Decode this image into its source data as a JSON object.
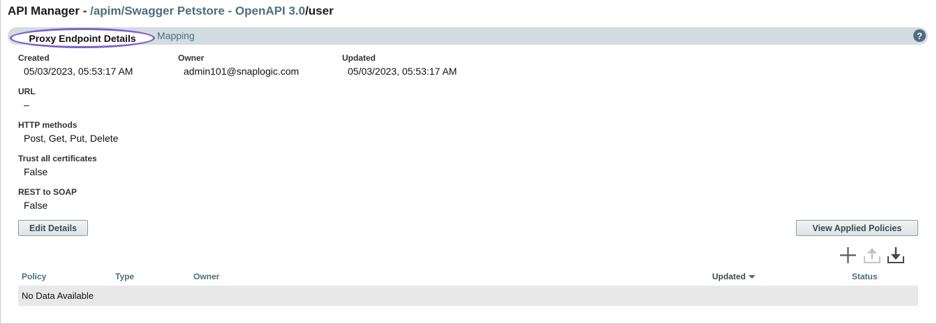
{
  "header": {
    "app_name": "API Manager - ",
    "path_link": "/apim/Swagger Petstore - OpenAPI 3.0",
    "path_tail": "/user"
  },
  "tabs": [
    {
      "label": "Proxy Endpoint Details",
      "active": true
    },
    {
      "label": "Mapping",
      "active": false
    }
  ],
  "help": {
    "glyph": "?"
  },
  "details": {
    "created": {
      "label": "Created",
      "value": "05/03/2023, 05:53:17 AM"
    },
    "owner": {
      "label": "Owner",
      "value": "admin101@snaplogic.com"
    },
    "updated": {
      "label": "Updated",
      "value": "05/03/2023, 05:53:17 AM"
    },
    "url": {
      "label": "URL",
      "value": "–"
    },
    "http_methods": {
      "label": "HTTP methods",
      "value": "Post, Get, Put, Delete"
    },
    "trust_certs": {
      "label": "Trust all certificates",
      "value": "False"
    },
    "rest_to_soap": {
      "label": "REST to SOAP",
      "value": "False"
    }
  },
  "buttons": {
    "edit_details": "Edit Details",
    "view_applied_policies": "View Applied Policies"
  },
  "toolbar_icons": [
    "add-icon",
    "upload-icon",
    "download-icon"
  ],
  "policy_table": {
    "columns": [
      "Policy",
      "Type",
      "Owner",
      "Updated",
      "Status"
    ],
    "sorted_column": "Updated",
    "sort_direction": "descending",
    "empty_text": "No Data Available"
  },
  "colors": {
    "accent": "#4c6e80",
    "tab_highlight": "#7b61c9",
    "tabbar_bg": "#d3dde1"
  }
}
